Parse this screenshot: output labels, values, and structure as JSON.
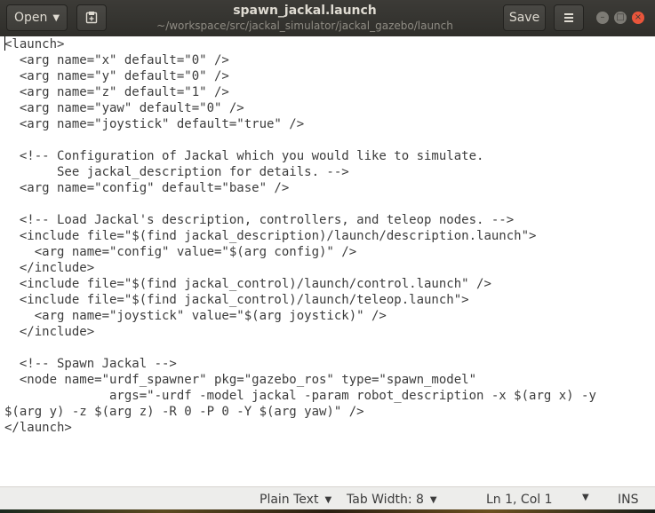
{
  "header": {
    "open_label": "Open",
    "save_label": "Save",
    "title": "spawn_jackal.launch",
    "subtitle": "~/workspace/src/jackal_simulator/jackal_gazebo/launch"
  },
  "editor": {
    "lines": [
      "<launch>",
      "  <arg name=\"x\" default=\"0\" />",
      "  <arg name=\"y\" default=\"0\" />",
      "  <arg name=\"z\" default=\"1\" />",
      "  <arg name=\"yaw\" default=\"0\" />",
      "  <arg name=\"joystick\" default=\"true\" />",
      "",
      "  <!-- Configuration of Jackal which you would like to simulate.",
      "       See jackal_description for details. -->",
      "  <arg name=\"config\" default=\"base\" />",
      "",
      "  <!-- Load Jackal's description, controllers, and teleop nodes. -->",
      "  <include file=\"$(find jackal_description)/launch/description.launch\">",
      "    <arg name=\"config\" value=\"$(arg config)\" />",
      "  </include>",
      "  <include file=\"$(find jackal_control)/launch/control.launch\" />",
      "  <include file=\"$(find jackal_control)/launch/teleop.launch\">",
      "    <arg name=\"joystick\" value=\"$(arg joystick)\" />",
      "  </include>",
      "",
      "  <!-- Spawn Jackal -->",
      "  <node name=\"urdf_spawner\" pkg=\"gazebo_ros\" type=\"spawn_model\"",
      "              args=\"-urdf -model jackal -param robot_description -x $(arg x) -y",
      "$(arg y) -z $(arg z) -R 0 -P 0 -Y $(arg yaw)\" />",
      "</launch>"
    ]
  },
  "statusbar": {
    "language": "Plain Text",
    "tab_width": "Tab Width: 8",
    "cursor_position": "Ln 1, Col 1",
    "insert_mode": "INS"
  },
  "icons": {
    "open_caret": "chevron-down-icon",
    "new_tab": "new-document-icon",
    "menu": "hamburger-menu-icon",
    "minimize": "minimize-icon",
    "maximize": "maximize-icon",
    "close": "close-icon"
  },
  "colors": {
    "headerbar": "#3c3b37",
    "close_button": "#e9553b",
    "statusbar": "#ededeb"
  }
}
